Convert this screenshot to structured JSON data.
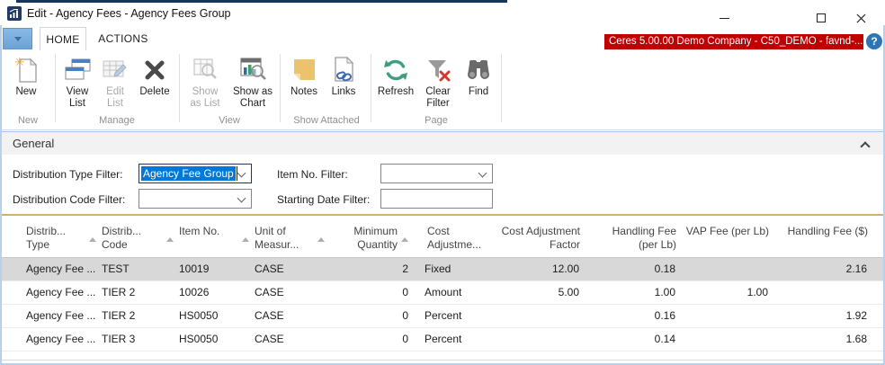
{
  "window": {
    "title": "Edit - Agency Fees - Agency Fees Group",
    "badge": "Ceres 5.00.00 Demo Company - C50_DEMO - favnd-...",
    "help": "?"
  },
  "tabs": {
    "home": "HOME",
    "actions": "ACTIONS"
  },
  "ribbon": {
    "buttons": {
      "new": "New",
      "view_list": "View\nList",
      "edit_list": "Edit\nList",
      "delete": "Delete",
      "show_as_list": "Show\nas List",
      "show_as_chart": "Show as\nChart",
      "notes": "Notes",
      "links": "Links",
      "refresh": "Refresh",
      "clear_filter": "Clear\nFilter",
      "find": "Find"
    },
    "groups": {
      "new": "New",
      "manage": "Manage",
      "view": "View",
      "show_attached": "Show Attached",
      "page": "Page"
    }
  },
  "general": {
    "title": "General"
  },
  "filters": {
    "distribution_type": {
      "label": "Distribution Type Filter:",
      "value": "Agency Fee Group"
    },
    "distribution_code": {
      "label": "Distribution Code Filter:",
      "value": ""
    },
    "item_no": {
      "label": "Item No. Filter:",
      "value": ""
    },
    "starting_date": {
      "label": "Starting Date Filter:",
      "value": ""
    }
  },
  "grid": {
    "columns": [
      {
        "label": "Distrib...\nType",
        "sortable": true,
        "align": "left"
      },
      {
        "label": "Distrib...\nCode",
        "sortable": true,
        "align": "left"
      },
      {
        "label": "Item No.",
        "sortable": true,
        "align": "left"
      },
      {
        "label": "Unit of\nMeasur...",
        "sortable": true,
        "align": "left"
      },
      {
        "label": "Minimum\nQuantity",
        "sortable": true,
        "align": "right"
      },
      {
        "label": "Cost\nAdjustme...",
        "sortable": false,
        "align": "left"
      },
      {
        "label": "Cost Adjustment\nFactor",
        "sortable": false,
        "align": "right"
      },
      {
        "label": "Handling Fee\n(per Lb)",
        "sortable": false,
        "align": "right"
      },
      {
        "label": "VAP Fee (per Lb)",
        "sortable": false,
        "align": "right"
      },
      {
        "label": "Handling Fee ($)",
        "sortable": false,
        "align": "right"
      }
    ],
    "rows": [
      {
        "selected": true,
        "cells": [
          "Agency Fee ...",
          "TEST",
          "10019",
          "CASE",
          "2",
          "Fixed",
          "12.00",
          "0.18",
          "",
          "2.16"
        ]
      },
      {
        "selected": false,
        "cells": [
          "Agency Fee ...",
          "TIER 2",
          "10026",
          "CASE",
          "0",
          "Amount",
          "5.00",
          "1.00",
          "1.00",
          ""
        ]
      },
      {
        "selected": false,
        "cells": [
          "Agency Fee ...",
          "TIER 2",
          "HS0050",
          "CASE",
          "0",
          "Percent",
          "",
          "0.16",
          "",
          "1.92"
        ]
      },
      {
        "selected": false,
        "cells": [
          "Agency Fee ...",
          "TIER 3",
          "HS0050",
          "CASE",
          "0",
          "Percent",
          "",
          "0.14",
          "",
          "1.68"
        ]
      }
    ]
  },
  "colors": {
    "badge_bg": "#c00000",
    "selection_blue": "#0078d7",
    "tab_dropdown_blue": "#7ab0df",
    "window_border_blue": "#b9d2ec",
    "selected_row_gray": "#d8d8d8",
    "notes_gold": "#ecc36d",
    "refresh_green": "#3f9e82",
    "clear_filter_red": "#d03a2b",
    "help_blue": "#2e75b6",
    "app_icon_navy": "#1d3b66"
  }
}
